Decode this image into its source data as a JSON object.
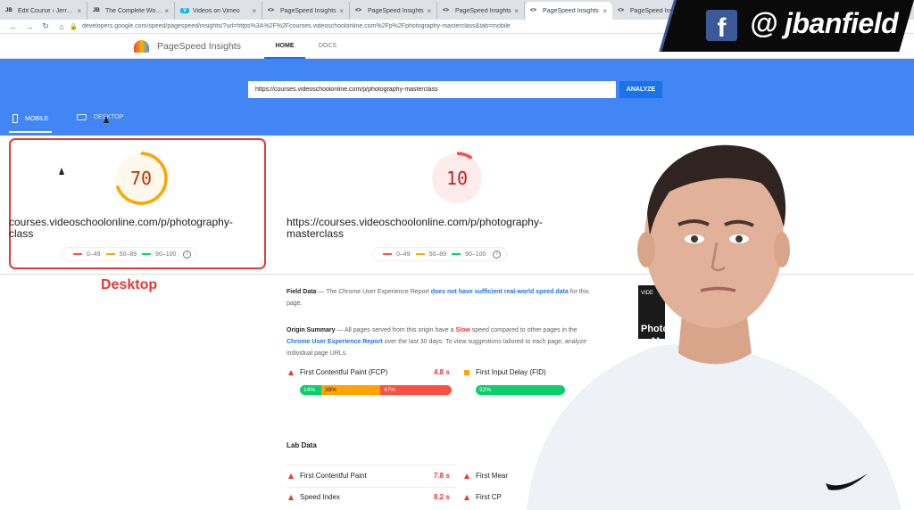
{
  "browser": {
    "tabs": [
      {
        "favicon": "JB",
        "title": "Edit Course › Jerry B..."
      },
      {
        "favicon": "JB",
        "title": "The Complete World..."
      },
      {
        "favicon": "V",
        "title": "Videos on Vimeo"
      },
      {
        "favicon": "<>",
        "title": "PageSpeed Insights"
      },
      {
        "favicon": "<>",
        "title": "PageSpeed Insights"
      },
      {
        "favicon": "<>",
        "title": "PageSpeed Insights"
      },
      {
        "favicon": "<>",
        "title": "PageSpeed Insights"
      },
      {
        "favicon": "<>",
        "title": "PageSpeed Insights"
      }
    ],
    "active_tab": 6,
    "url": "developers.google.com/speed/pagespeed/insights/?url=https%3A%2F%2Fcourses.videoschoolonline.com%2Fp%2Fphotography-masterclass&tab=mobile"
  },
  "site": {
    "name": "PageSpeed Insights",
    "nav": {
      "home": "HOME",
      "docs": "DOCS"
    }
  },
  "search": {
    "value": "https://courses.videoschoolonline.com/p/photography-masterclass",
    "button": "ANALYZE"
  },
  "device_tabs": {
    "mobile": "MOBILE",
    "desktop": "DESKTOP"
  },
  "scores": {
    "desktop": {
      "score": "70",
      "url_line1": "courses.videoschoolonline.com/p/photography-",
      "url_line2": "class"
    },
    "mobile": {
      "score": "10",
      "url_line1": "https://courses.videoschoolonline.com/p/photography-",
      "url_line2": "masterclass"
    },
    "legend": [
      "0–49",
      "50–89",
      "90–100"
    ]
  },
  "annotation": {
    "label": "Desktop",
    "color": "#e53935"
  },
  "field_data": {
    "title": "Field Data",
    "text_1": " — The Chrome User Experience Report ",
    "link": "does not have sufficient real-world speed data",
    "text_2": " for this page."
  },
  "origin_summary": {
    "title": "Origin Summary",
    "t1": " — All pages served from this origin have a ",
    "slow": "Slow",
    "t2": " speed compared to other pages in the ",
    "report": "Chrome User Experience Report",
    "t3": " over the last 30 days. To view suggestions tailored to each page, analyze individual page URLs.",
    "metrics": [
      {
        "name": "First Contentful Paint (FCP)",
        "value": "4.8 s",
        "dist": [
          "14%",
          "39%",
          "47%"
        ]
      },
      {
        "name": "First Input Delay (FID)",
        "value": "",
        "dist": [
          "92%"
        ]
      }
    ]
  },
  "lab_data": {
    "title": "Lab Data",
    "metrics": [
      {
        "name": "First Contentful Paint",
        "value": "7.8 s"
      },
      {
        "name": "Speed Index",
        "value": "8.2 s"
      }
    ],
    "right_metrics": [
      "First Mear",
      "First CP"
    ]
  },
  "overlay": {
    "social_handle": "@ jbanfield",
    "facebook_glyph": "f",
    "video_card_text": [
      "VIDE",
      "Photog",
      "Mast"
    ]
  },
  "colors": {
    "accent_blue": "#4285f4",
    "fail": "#ff4e42",
    "average": "#ffa400",
    "pass": "#0cce6b"
  }
}
